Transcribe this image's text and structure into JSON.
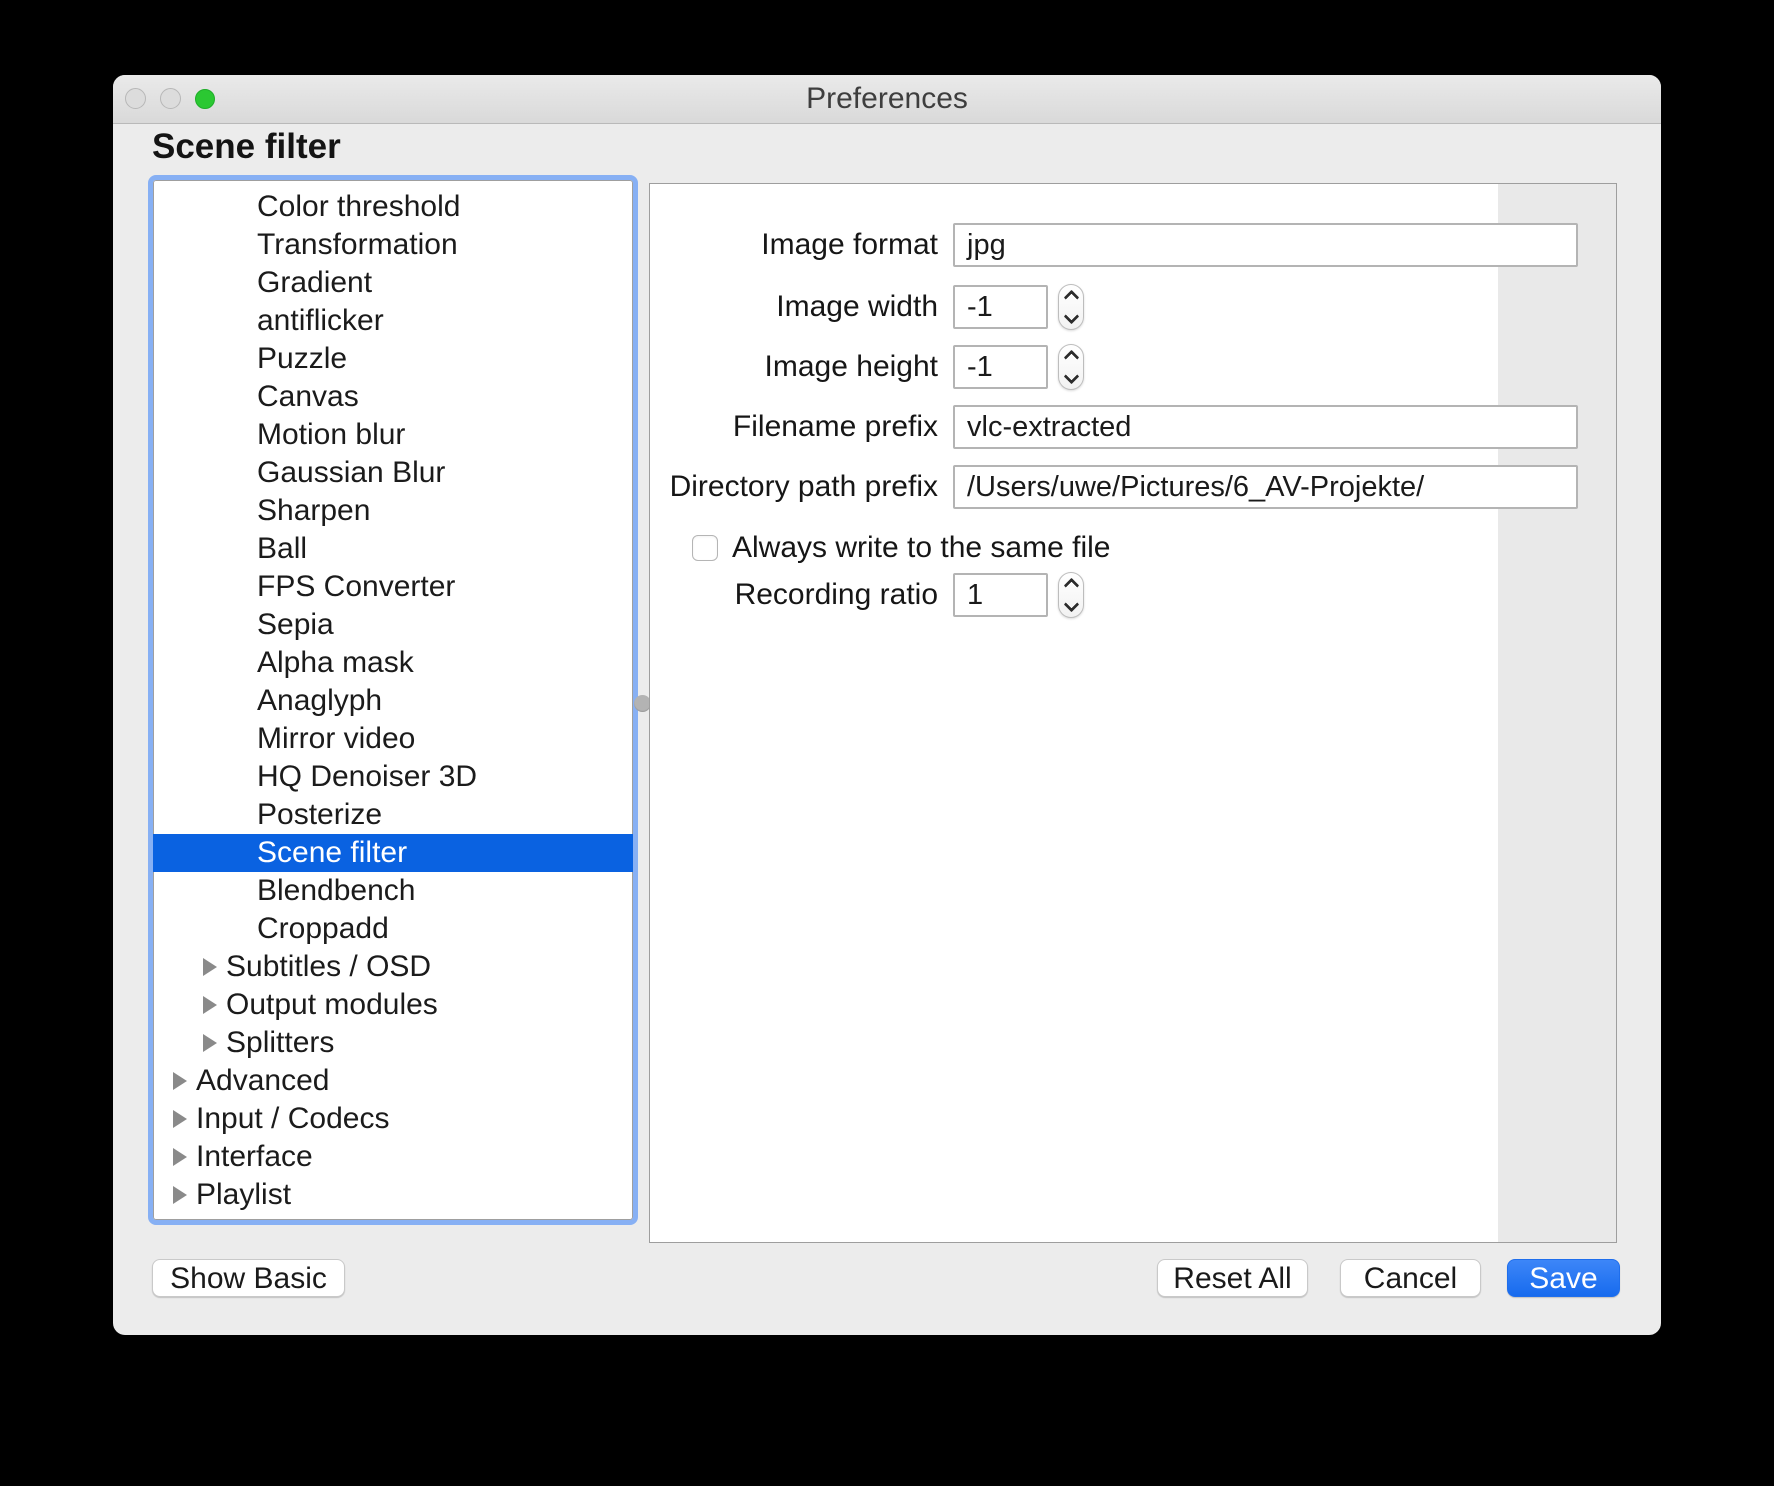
{
  "window": {
    "title": "Preferences"
  },
  "page": {
    "heading": "Scene filter"
  },
  "sidebar": {
    "items": [
      {
        "label": "Color threshold",
        "level": 3,
        "selected": false,
        "expandable": false
      },
      {
        "label": "Transformation",
        "level": 3,
        "selected": false,
        "expandable": false
      },
      {
        "label": "Gradient",
        "level": 3,
        "selected": false,
        "expandable": false
      },
      {
        "label": "antiflicker",
        "level": 3,
        "selected": false,
        "expandable": false
      },
      {
        "label": "Puzzle",
        "level": 3,
        "selected": false,
        "expandable": false
      },
      {
        "label": "Canvas",
        "level": 3,
        "selected": false,
        "expandable": false
      },
      {
        "label": "Motion blur",
        "level": 3,
        "selected": false,
        "expandable": false
      },
      {
        "label": "Gaussian Blur",
        "level": 3,
        "selected": false,
        "expandable": false
      },
      {
        "label": "Sharpen",
        "level": 3,
        "selected": false,
        "expandable": false
      },
      {
        "label": "Ball",
        "level": 3,
        "selected": false,
        "expandable": false
      },
      {
        "label": "FPS Converter",
        "level": 3,
        "selected": false,
        "expandable": false
      },
      {
        "label": "Sepia",
        "level": 3,
        "selected": false,
        "expandable": false
      },
      {
        "label": "Alpha mask",
        "level": 3,
        "selected": false,
        "expandable": false
      },
      {
        "label": "Anaglyph",
        "level": 3,
        "selected": false,
        "expandable": false
      },
      {
        "label": "Mirror video",
        "level": 3,
        "selected": false,
        "expandable": false
      },
      {
        "label": "HQ Denoiser 3D",
        "level": 3,
        "selected": false,
        "expandable": false
      },
      {
        "label": "Posterize",
        "level": 3,
        "selected": false,
        "expandable": false
      },
      {
        "label": "Scene filter",
        "level": 3,
        "selected": true,
        "expandable": false
      },
      {
        "label": "Blendbench",
        "level": 3,
        "selected": false,
        "expandable": false
      },
      {
        "label": "Croppadd",
        "level": 3,
        "selected": false,
        "expandable": false
      },
      {
        "label": "Subtitles / OSD",
        "level": 2,
        "selected": false,
        "expandable": true
      },
      {
        "label": "Output modules",
        "level": 2,
        "selected": false,
        "expandable": true
      },
      {
        "label": "Splitters",
        "level": 2,
        "selected": false,
        "expandable": true
      },
      {
        "label": "Advanced",
        "level": 1,
        "selected": false,
        "expandable": true
      },
      {
        "label": "Input / Codecs",
        "level": 1,
        "selected": false,
        "expandable": true
      },
      {
        "label": "Interface",
        "level": 1,
        "selected": false,
        "expandable": true
      },
      {
        "label": "Playlist",
        "level": 1,
        "selected": false,
        "expandable": true
      }
    ]
  },
  "form": {
    "rows": [
      {
        "type": "text",
        "label": "Image format",
        "value": "jpg"
      },
      {
        "type": "spin",
        "label": "Image width",
        "value": "-1"
      },
      {
        "type": "spin",
        "label": "Image height",
        "value": "-1"
      },
      {
        "type": "text",
        "label": "Filename prefix",
        "value": "vlc-extracted"
      },
      {
        "type": "text",
        "label": "Directory path prefix",
        "value": "/Users/uwe/Pictures/6_AV-Projekte/"
      },
      {
        "type": "checkbox",
        "label": "Always write to the same file",
        "checked": false
      },
      {
        "type": "spin",
        "label": "Recording ratio",
        "value": "1"
      }
    ]
  },
  "footer": {
    "buttons": [
      {
        "label": "Show Basic",
        "primary": false
      },
      {
        "label": "Reset All",
        "primary": false
      },
      {
        "label": "Cancel",
        "primary": false
      },
      {
        "label": "Save",
        "primary": true
      }
    ]
  },
  "colors": {
    "selection_blue": "#0a62e1",
    "focus_ring": "#87b0f4",
    "save_gradient_top": "#3d86f8",
    "save_gradient_bottom": "#176bee",
    "traffic_green": "#2bc832"
  }
}
